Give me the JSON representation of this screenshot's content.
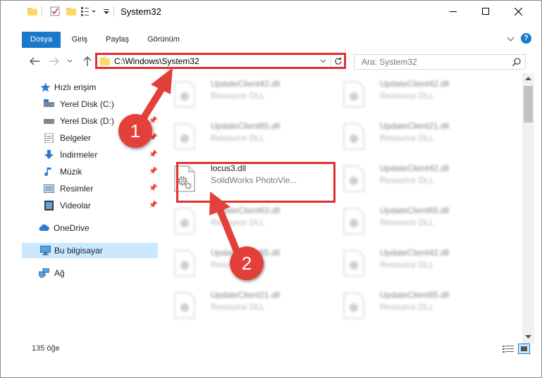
{
  "window": {
    "title": "System32",
    "controls": [
      "minimize",
      "maximize",
      "close"
    ]
  },
  "ribbon": {
    "tabs": [
      {
        "label": "Dosya",
        "active": true
      },
      {
        "label": "Giriş",
        "active": false
      },
      {
        "label": "Paylaş",
        "active": false
      },
      {
        "label": "Görünüm",
        "active": false
      }
    ]
  },
  "address_bar": {
    "path": "C:\\Windows\\System32"
  },
  "search": {
    "placeholder": "Ara: System32"
  },
  "sidebar": {
    "items": [
      {
        "label": "Hızlı erişim",
        "icon": "star-icon",
        "pinned": false
      },
      {
        "label": "Yerel Disk (C:)",
        "icon": "drive-icon",
        "pinned": true
      },
      {
        "label": "Yerel Disk (D:)",
        "icon": "drive-icon",
        "pinned": true
      },
      {
        "label": "Belgeler",
        "icon": "documents-icon",
        "pinned": true
      },
      {
        "label": "İndirmeler",
        "icon": "download-icon",
        "pinned": true
      },
      {
        "label": "Müzik",
        "icon": "music-icon",
        "pinned": true
      },
      {
        "label": "Resimler",
        "icon": "pictures-icon",
        "pinned": true
      },
      {
        "label": "Videolar",
        "icon": "video-icon",
        "pinned": true
      },
      {
        "label": "OneDrive",
        "icon": "cloud-icon",
        "pinned": false
      },
      {
        "label": "Bu bilgisayar",
        "icon": "computer-icon",
        "pinned": false,
        "selected": true
      },
      {
        "label": "Ağ",
        "icon": "network-icon",
        "pinned": false
      }
    ]
  },
  "files": [
    {
      "name": "UpdateClient42.dll",
      "type": "Resource DLL",
      "blurred": true
    },
    {
      "name": "UpdateClient42.dll",
      "type": "Resource DLL",
      "blurred": true
    },
    {
      "name": "UpdateClient65.dll",
      "type": "Resource DLL",
      "blurred": true
    },
    {
      "name": "UpdateClient21.dll",
      "type": "Resource DLL",
      "blurred": true
    },
    {
      "name": "locus3.dll",
      "type": "SolidWorks PhotoVie...",
      "blurred": false,
      "highlighted": true
    },
    {
      "name": "UpdateClient42.dll",
      "type": "Resource DLL",
      "blurred": true
    },
    {
      "name": "UpdateClient63.dll",
      "type": "Resource DLL",
      "blurred": true
    },
    {
      "name": "UpdateClient65.dll",
      "type": "Resource DLL",
      "blurred": true
    },
    {
      "name": "UpdateClient65.dll",
      "type": "Resource DLL",
      "blurred": true
    },
    {
      "name": "UpdateClient42.dll",
      "type": "Resource DLL",
      "blurred": true
    },
    {
      "name": "UpdateClient21.dll",
      "type": "Resource DLL",
      "blurred": true
    },
    {
      "name": "UpdateClient65.dll",
      "type": "Resource DLL",
      "blurred": true
    }
  ],
  "status": {
    "item_count": "135 öğe"
  },
  "callouts": [
    "1",
    "2"
  ],
  "colors": {
    "accent": "#1979ca",
    "highlight_border": "#e03030",
    "badge": "#e4403a",
    "selected_bg": "#cce8ff"
  }
}
